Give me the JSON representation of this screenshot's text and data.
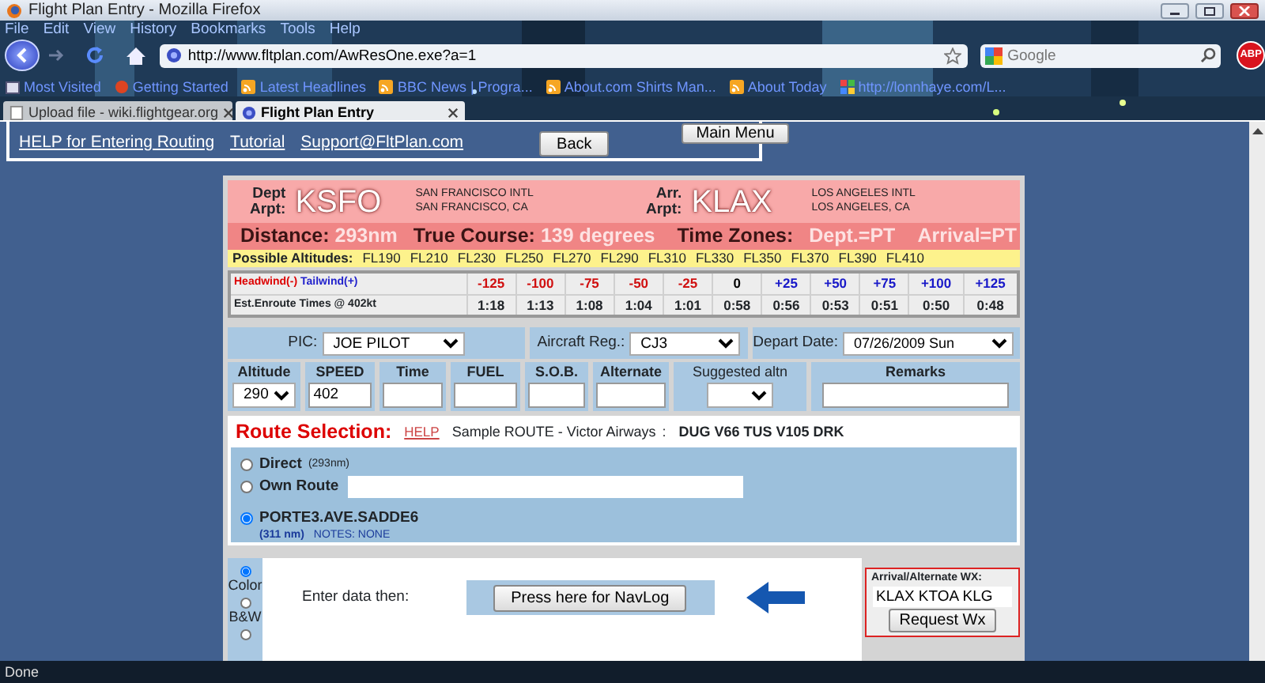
{
  "window": {
    "title": "Flight Plan Entry - Mozilla Firefox"
  },
  "menu": [
    "File",
    "Edit",
    "View",
    "History",
    "Bookmarks",
    "Tools",
    "Help"
  ],
  "address": {
    "value": "http://www.fltplan.com/AwResOne.exe?a=1"
  },
  "search": {
    "placeholder": "Google"
  },
  "adblock_label": "ABP",
  "bookmarks": [
    {
      "label": "Most Visited",
      "kind": "folder"
    },
    {
      "label": "Getting Started",
      "kind": "start"
    },
    {
      "label": "Latest Headlines",
      "kind": "feed"
    },
    {
      "label": "BBC News | Progra...",
      "kind": "feed"
    },
    {
      "label": "About.com Shirts Man...",
      "kind": "feed"
    },
    {
      "label": "About Today",
      "kind": "feed"
    },
    {
      "label": "http://lonnhaye.com/L...",
      "kind": "web"
    }
  ],
  "tabs": [
    {
      "label": "Upload file - wiki.flightgear.org",
      "selected": false
    },
    {
      "label": "Flight Plan Entry",
      "selected": true
    }
  ],
  "header_links": [
    "HELP for Entering Routing",
    "Tutorial",
    "Support@FltPlan.com"
  ],
  "back_button": "Back",
  "main_menu_button": "Main Menu",
  "departure": {
    "label_1": "Dept",
    "label_2": "Arpt:",
    "code": "KSFO",
    "name": "SAN FRANCISCO INTL",
    "city": "SAN FRANCISCO, CA"
  },
  "arrival": {
    "label_1": "Arr.",
    "label_2": "Arpt:",
    "code": "KLAX",
    "name": "LOS ANGELES INTL",
    "city": "LOS ANGELES, CA"
  },
  "summary": [
    {
      "label": "Distance:",
      "value": "293nm"
    },
    {
      "label": "True Course:",
      "value": "139 degrees"
    }
  ],
  "time_zones": {
    "label": "Time Zones:",
    "departure": "Dept.=PT",
    "arrival": "Arrival=PT"
  },
  "altitudes": {
    "label": "Possible Altitudes:",
    "levels": [
      "FL190",
      "FL210",
      "FL230",
      "FL250",
      "FL270",
      "FL290",
      "FL310",
      "FL330",
      "FL350",
      "FL370",
      "FL390",
      "FL410"
    ]
  },
  "wind_table": {
    "headwind_label": "Headwind(-)",
    "tailwind_label": "Tailwind(+)",
    "times_label": "Est.Enroute Times @ 402kt",
    "columns": [
      {
        "wind": "-125",
        "time": "1:18",
        "kind": "headwind"
      },
      {
        "wind": "-100",
        "time": "1:13",
        "kind": "headwind"
      },
      {
        "wind": "-75",
        "time": "1:08",
        "kind": "headwind"
      },
      {
        "wind": "-50",
        "time": "1:04",
        "kind": "headwind"
      },
      {
        "wind": "-25",
        "time": "1:01",
        "kind": "headwind"
      },
      {
        "wind": "0",
        "time": "0:58",
        "kind": "calm"
      },
      {
        "wind": "+25",
        "time": "0:56",
        "kind": "tailwind"
      },
      {
        "wind": "+50",
        "time": "0:53",
        "kind": "tailwind"
      },
      {
        "wind": "+75",
        "time": "0:51",
        "kind": "tailwind"
      },
      {
        "wind": "+100",
        "time": "0:50",
        "kind": "tailwind"
      },
      {
        "wind": "+125",
        "time": "0:48",
        "kind": "tailwind"
      }
    ]
  },
  "pic": {
    "label": "PIC:",
    "value": "JOE PILOT"
  },
  "aircraft": {
    "label": "Aircraft Reg.:",
    "value": "CJ3"
  },
  "depart_date": {
    "label": "Depart Date:",
    "value": "07/26/2009 Sun"
  },
  "fields": [
    {
      "label": "Altitude",
      "kind": "select",
      "value": "290"
    },
    {
      "label": "SPEED",
      "kind": "text",
      "value": "402"
    },
    {
      "label": "Time",
      "kind": "text"
    },
    {
      "label": "FUEL",
      "kind": "text"
    },
    {
      "label": "S.O.B.",
      "kind": "text"
    },
    {
      "label": "Alternate",
      "kind": "text"
    },
    {
      "label": "Suggested altn",
      "kind": "select"
    },
    {
      "label": "Remarks",
      "kind": "text"
    }
  ],
  "route": {
    "title": "Route Selection:",
    "help": "HELP",
    "sample_label": "Sample ROUTE - Victor Airways",
    "separator": ":",
    "sample": "DUG V66 TUS V105 DRK",
    "options": [
      {
        "kind": "direct",
        "label": "Direct",
        "note": "(293nm)",
        "selected": false
      },
      {
        "kind": "own",
        "label": "Own Route",
        "selected": false
      },
      {
        "kind": "preferred",
        "label": "PORTE3.AVE.SADDE6",
        "distance": "(311 nm)",
        "note": "NOTES: NONE",
        "selected": true
      }
    ]
  },
  "print_options": [
    {
      "label": "Color",
      "selected": true
    },
    {
      "label": "B&W",
      "selected": false
    },
    {
      "selected": false
    }
  ],
  "navlog": {
    "prompt": "Enter data then:",
    "button": "Press here for NavLog"
  },
  "wx": {
    "label": "Arrival/Alternate WX:",
    "value": "KLAX KTOA KLG",
    "button": "Request Wx"
  },
  "status_bar": "Done"
}
